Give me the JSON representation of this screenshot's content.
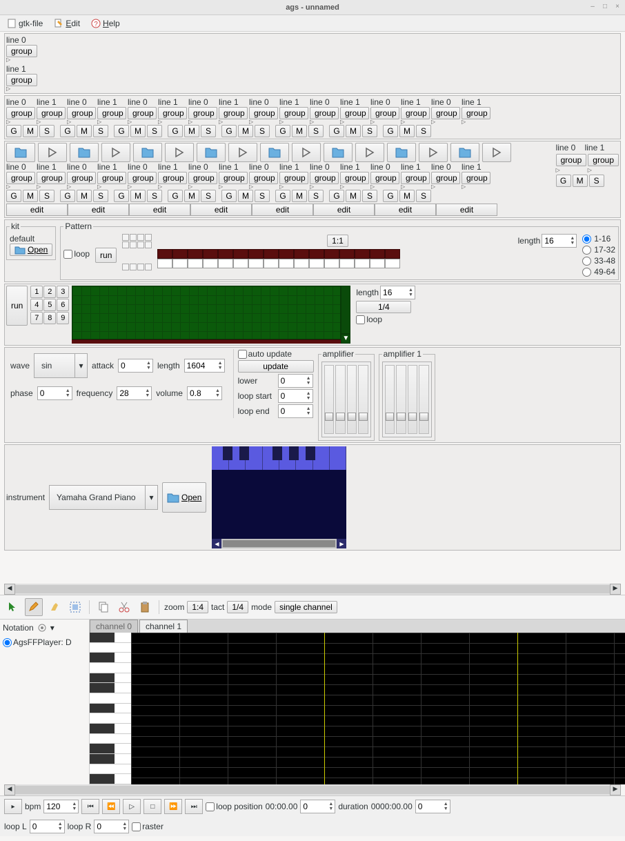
{
  "window": {
    "title": "ags - unnamed"
  },
  "menu": {
    "file": "gtk-file",
    "edit": "Edit",
    "help": "Help"
  },
  "lines": {
    "line0": "line 0",
    "line1": "line 1",
    "group": "group",
    "g": "G",
    "m": "M",
    "s": "S",
    "edit": "edit"
  },
  "kit": {
    "legend": "kit",
    "default": "default",
    "open": "Open"
  },
  "pattern": {
    "legend": "Pattern",
    "loop": "loop",
    "run": "run",
    "ratio": "1:1",
    "length_label": "length",
    "length_value": "16",
    "ranges": [
      "1-16",
      "17-32",
      "33-48",
      "49-64"
    ]
  },
  "seq": {
    "run": "run",
    "nums": [
      "1",
      "2",
      "3",
      "4",
      "5",
      "6",
      "7",
      "8",
      "9"
    ],
    "length_label": "length",
    "length_value": "16",
    "ratio": "1/4",
    "loop": "loop"
  },
  "osc": {
    "wave_label": "wave",
    "wave_value": "sin",
    "attack_label": "attack",
    "attack_value": "0",
    "length_label": "length",
    "length_value": "1604",
    "phase_label": "phase",
    "phase_value": "0",
    "frequency_label": "frequency",
    "frequency_value": "28",
    "volume_label": "volume",
    "volume_value": "0.8",
    "auto_update": "auto update",
    "update": "update",
    "lower_label": "lower",
    "lower_value": "0",
    "loop_start_label": "loop start",
    "loop_start_value": "0",
    "loop_end_label": "loop end",
    "loop_end_value": "0",
    "amp1_legend": "amplifier",
    "amp2_legend": "amplifier 1"
  },
  "inst": {
    "label": "instrument",
    "value": "Yamaha Grand Piano",
    "open": "Open"
  },
  "toolbar": {
    "zoom_label": "zoom",
    "zoom_value": "1:4",
    "tact_label": "tact",
    "tact_value": "1/4",
    "mode_label": "mode",
    "mode_value": "single channel"
  },
  "sidebar": {
    "notation": "Notation",
    "player": "AgsFFPlayer: D"
  },
  "tabs": {
    "ch0": "channel 0",
    "ch1": "channel 1"
  },
  "transport": {
    "bpm_label": "bpm",
    "bpm_value": "120",
    "loop_position_label": "loop position",
    "loop_position_time": "00:00.00",
    "loop_position_value": "0",
    "duration_label": "duration",
    "duration_time": "0000:00.00",
    "duration_value": "0",
    "loop_l_label": "loop L",
    "loop_l_value": "0",
    "loop_r_label": "loop R",
    "loop_r_value": "0",
    "raster": "raster"
  }
}
